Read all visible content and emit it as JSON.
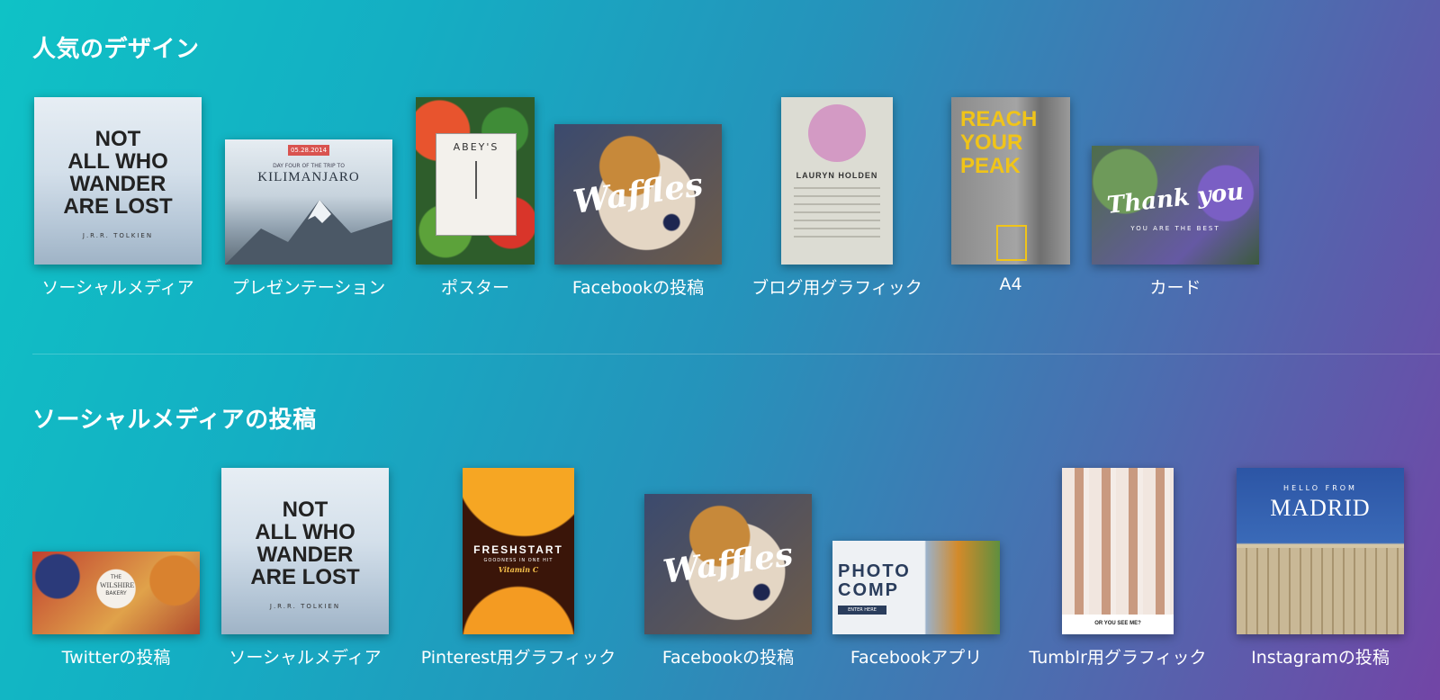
{
  "sections": {
    "popular": {
      "title": "人気のデザイン",
      "items": [
        {
          "label": "ソーシャルメディア",
          "thumb_text": [
            "NOT",
            "ALL WHO",
            "WANDER",
            "ARE LOST",
            "J.R.R. TOLKIEN"
          ]
        },
        {
          "label": "プレゼンテーション",
          "thumb_text": [
            "05.28.2014",
            "DAY FOUR OF THE TRIP TO",
            "KILIMANJARO"
          ]
        },
        {
          "label": "ポスター",
          "thumb_text": [
            "ABEY'S"
          ]
        },
        {
          "label": "Facebookの投稿",
          "thumb_text": [
            "Waffles"
          ]
        },
        {
          "label": "ブログ用グラフィック",
          "thumb_text": [
            "LAURYN HOLDEN"
          ]
        },
        {
          "label": "A4",
          "thumb_text": [
            "REACH",
            "YOUR",
            "PEAK"
          ]
        },
        {
          "label": "カード",
          "thumb_text": [
            "Thank you",
            "YOU ARE THE BEST"
          ]
        }
      ]
    },
    "social": {
      "title": "ソーシャルメディアの投稿",
      "items": [
        {
          "label": "Twitterの投稿",
          "thumb_text": [
            "THE",
            "WILSHIRE",
            "BAKERY"
          ]
        },
        {
          "label": "ソーシャルメディア",
          "thumb_text": [
            "NOT",
            "ALL WHO",
            "WANDER",
            "ARE LOST",
            "J.R.R. TOLKIEN"
          ]
        },
        {
          "label": "Pinterest用グラフィック",
          "thumb_text": [
            "FRESHSTART",
            "GOODNESS IN ONE HIT",
            "Vitamin C"
          ]
        },
        {
          "label": "Facebookの投稿",
          "thumb_text": [
            "Waffles"
          ]
        },
        {
          "label": "Facebookアプリ",
          "thumb_text": [
            "PHOTO",
            "COMP",
            "ENTER HERE"
          ]
        },
        {
          "label": "Tumblr用グラフィック",
          "thumb_text": [
            "OR YOU SEE ME?"
          ]
        },
        {
          "label": "Instagramの投稿",
          "thumb_text": [
            "HELLO FROM",
            "MADRID"
          ]
        }
      ]
    }
  },
  "colors": {
    "gradient_start": "#0fc2c6",
    "gradient_end": "#7245a6",
    "text": "#ffffff",
    "accent_red": "#d9534f",
    "accent_yellow": "#f0c419"
  }
}
